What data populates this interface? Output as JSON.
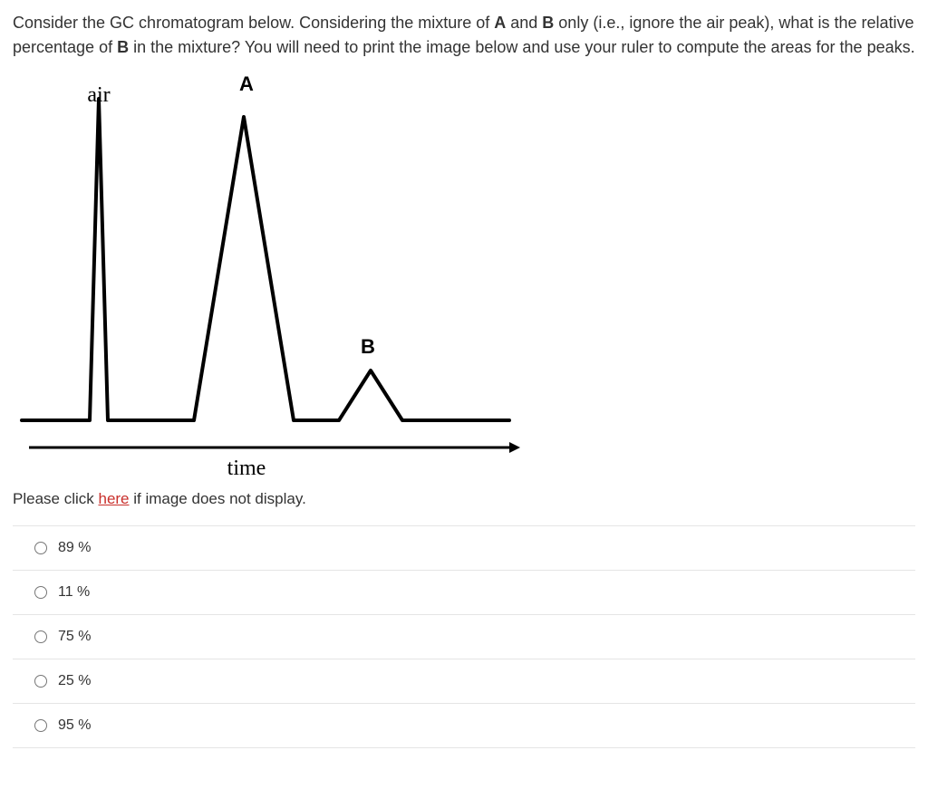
{
  "question": {
    "segments": [
      {
        "text": "Consider the GC chromatogram below. Considering the mixture of ",
        "bold": false
      },
      {
        "text": "A",
        "bold": true
      },
      {
        "text": " and ",
        "bold": false
      },
      {
        "text": "B",
        "bold": true
      },
      {
        "text": " only (i.e., ignore the air peak), what is the relative percentage of ",
        "bold": false
      },
      {
        "text": "B",
        "bold": true
      },
      {
        "text": " in the mixture? You will need to print the image below and use your ruler to compute the areas for the peaks.",
        "bold": false
      }
    ]
  },
  "chart_data": {
    "type": "line",
    "title": "",
    "xlabel": "time",
    "ylabel": "",
    "annotations": [
      "air",
      "A",
      "B"
    ],
    "peaks": [
      {
        "label": "air",
        "center_x": 95,
        "apex_y": 35,
        "half_width": 10,
        "baseline_y": 390
      },
      {
        "label": "A",
        "center_x": 255,
        "apex_y": 55,
        "half_width": 55,
        "baseline_y": 390
      },
      {
        "label": "B",
        "center_x": 395,
        "apex_y": 335,
        "half_width": 35,
        "baseline_y": 390
      }
    ],
    "baseline_y": 390,
    "x_range": [
      0,
      560
    ],
    "y_range": [
      0,
      450
    ]
  },
  "fallback": {
    "prefix": "Please click ",
    "link": "here",
    "suffix": " if image does not display."
  },
  "options": [
    {
      "label": "89 %"
    },
    {
      "label": "11 %"
    },
    {
      "label": "75 %"
    },
    {
      "label": "25 %"
    },
    {
      "label": "95 %"
    }
  ]
}
